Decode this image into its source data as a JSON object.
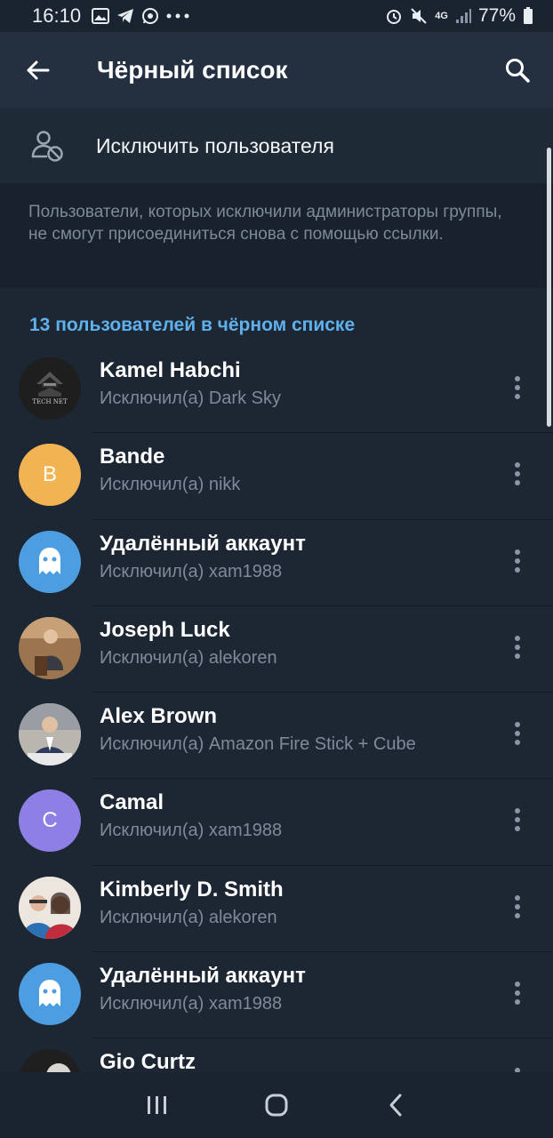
{
  "status_bar": {
    "time": "16:10",
    "left_icons": [
      "gallery-icon",
      "telegram-icon",
      "whatsapp-icon",
      "more-dots-icon"
    ],
    "right_icons": [
      "alarm-icon",
      "mute-icon",
      "4g-icon",
      "signal-icon",
      "battery-icon"
    ],
    "network": "4G",
    "battery": "77%"
  },
  "app_bar": {
    "title": "Чёрный список",
    "back_icon": "arrow-left-icon",
    "search_icon": "search-icon"
  },
  "ban_action": {
    "label": "Исключить пользователя",
    "icon": "user-block-icon"
  },
  "info_text": "Пользователи, которых исключили администраторы группы, не смогут присоединиться снова с помощью ссылки.",
  "section_header": "13 пользователей в чёрном списке",
  "users": [
    {
      "name": "Kamel Habchi",
      "subtitle": "Исключил(а) Dark Sky",
      "avatar": "photo",
      "avatar_text": "TECH NET"
    },
    {
      "name": "Bande",
      "subtitle": "Исключил(а) nikk",
      "avatar": "letter",
      "avatar_text": "B",
      "avatar_color": "#f2b452"
    },
    {
      "name": "Удалённый аккаунт",
      "subtitle": "Исключил(а) xam1988",
      "avatar": "ghost",
      "avatar_color": "#4d9ee0"
    },
    {
      "name": "Joseph Luck",
      "subtitle": "Исключил(а) alekoren",
      "avatar": "photo"
    },
    {
      "name": "Alex Brown",
      "subtitle": "Исключил(а) Amazon Fire Stick + Cube",
      "avatar": "photo"
    },
    {
      "name": "Camal",
      "subtitle": "Исключил(а) xam1988",
      "avatar": "letter",
      "avatar_text": "C",
      "avatar_color": "#8e7fe6"
    },
    {
      "name": "Kimberly D. Smith",
      "subtitle": "Исключил(а) alekoren",
      "avatar": "photo"
    },
    {
      "name": "Удалённый аккаунт",
      "subtitle": "Исключил(а) xam1988",
      "avatar": "ghost",
      "avatar_color": "#4d9ee0"
    },
    {
      "name": "Gio Curtz",
      "subtitle": "",
      "avatar": "photo"
    }
  ],
  "nav_bar": {
    "icons": [
      "recent-apps-icon",
      "home-icon",
      "back-icon"
    ]
  },
  "colors": {
    "background": "#1d2733",
    "app_bar": "#243040",
    "accent": "#5fb0ec",
    "secondary_text": "#7d8b99"
  }
}
